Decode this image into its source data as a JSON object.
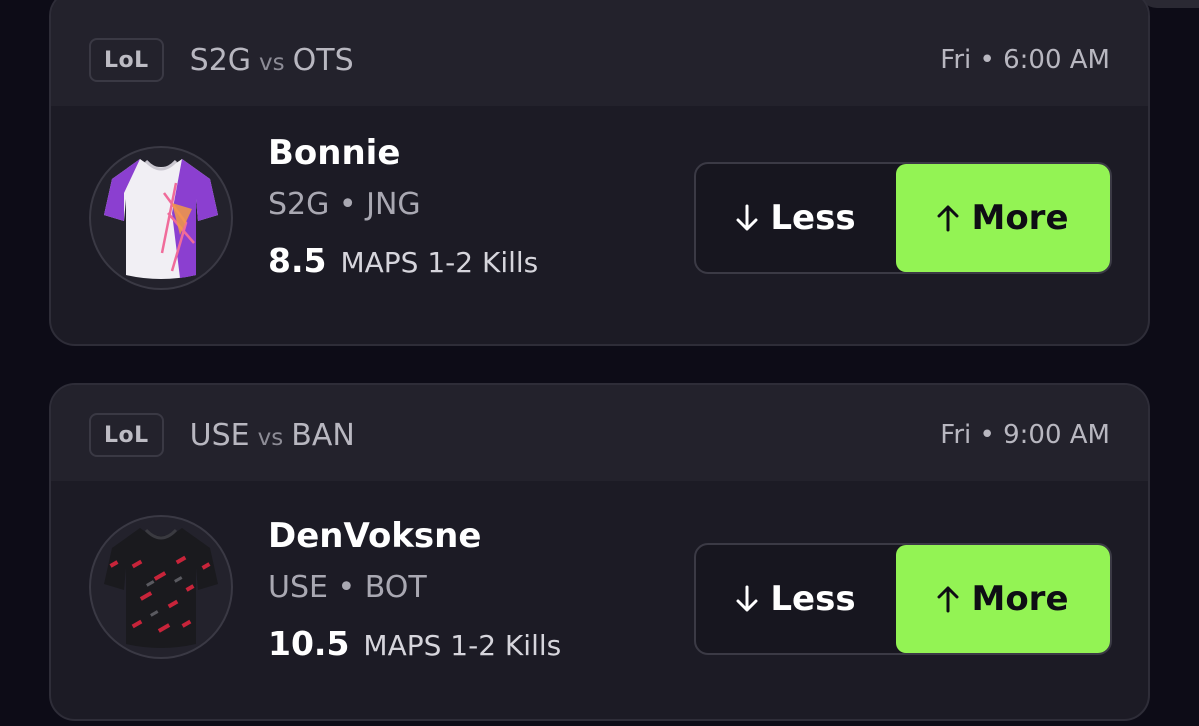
{
  "colors": {
    "background": "#0d0c17",
    "card": "#1c1b25",
    "card_header": "#23222c",
    "more_button": "#93f354",
    "less_button": "#17161f"
  },
  "cards": [
    {
      "league": "LoL",
      "team_a": "S2G",
      "vs": "vs",
      "team_b": "OTS",
      "time": "Fri • 6:00 AM",
      "player": {
        "name": "Bonnie",
        "team": "S2G",
        "position": "JNG",
        "meta": "S2G • JNG",
        "line": "8.5",
        "stat": "MAPS 1-2 Kills",
        "jersey": "purple-white-jersey-icon"
      },
      "less_label": "Less",
      "more_label": "More"
    },
    {
      "league": "LoL",
      "team_a": "USE",
      "vs": "vs",
      "team_b": "BAN",
      "time": "Fri • 9:00 AM",
      "player": {
        "name": "DenVoksne",
        "team": "USE",
        "position": "BOT",
        "meta": "USE • BOT",
        "line": "10.5",
        "stat": "MAPS 1-2 Kills",
        "jersey": "black-red-jersey-icon"
      },
      "less_label": "Less",
      "more_label": "More"
    }
  ]
}
